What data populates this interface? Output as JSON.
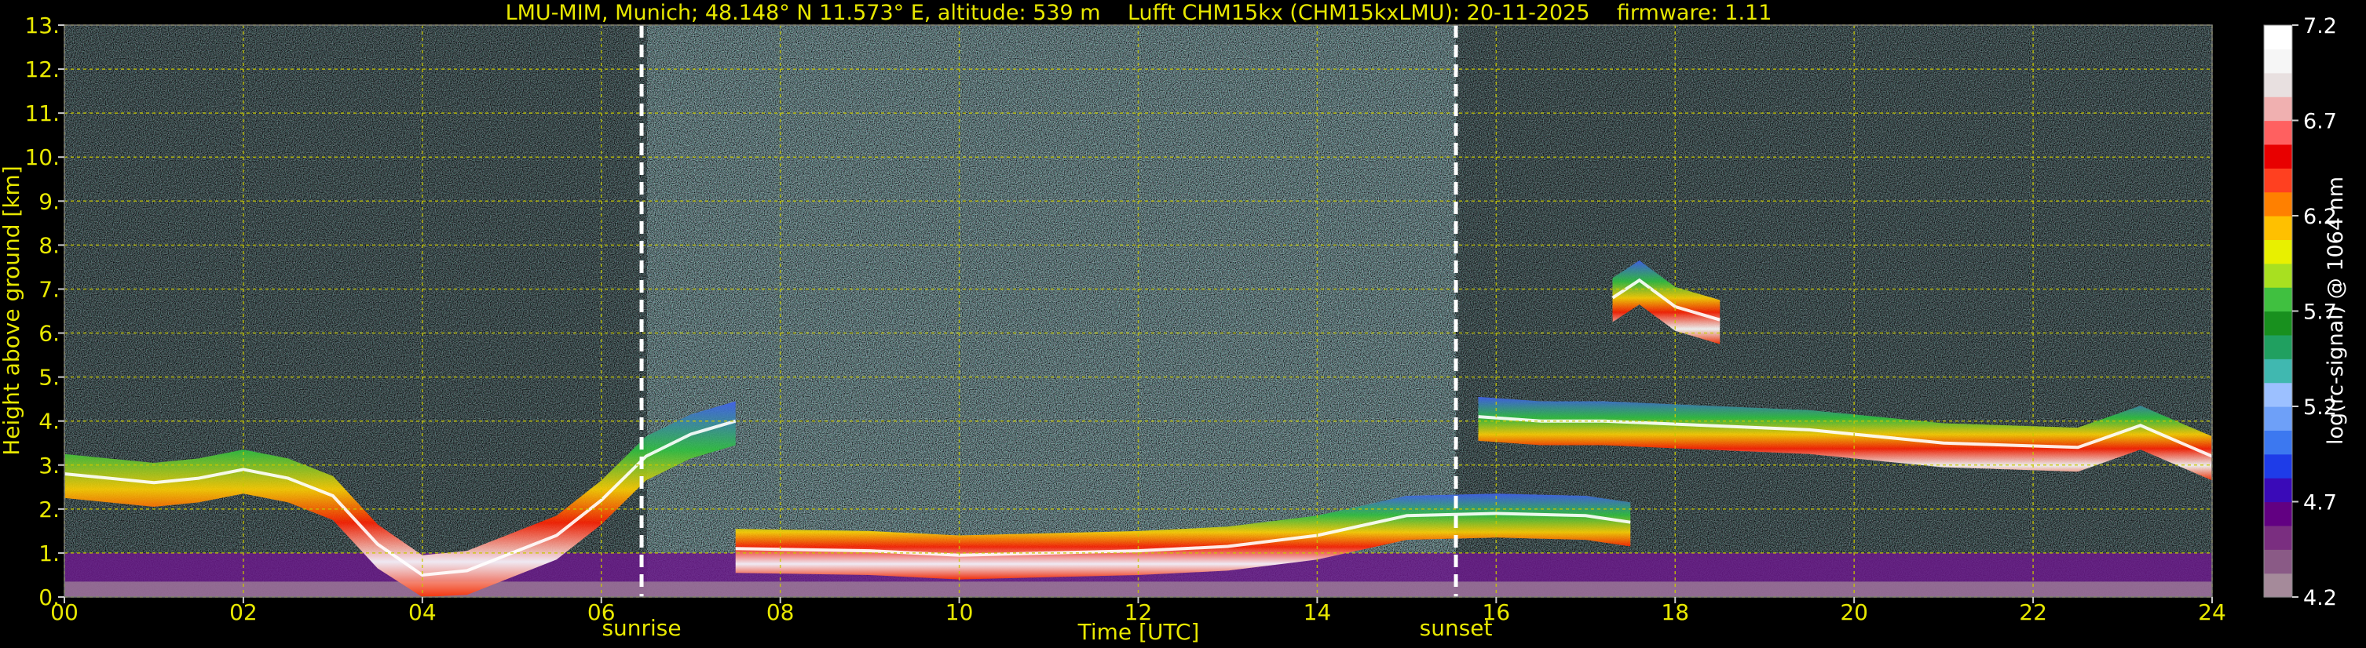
{
  "chart_data": {
    "type": "heatmap",
    "title": "LMU-MIM, Munich; 48.148° N 11.573° E, altitude: 539 m    Lufft CHM15kx (CHM15kxLMU): 20-11-2025    firmware: 1.11",
    "xlabel": "Time [UTC]",
    "ylabel": "Height above ground [km]",
    "colorbar_label": "log(rc-signal) @ 1064 nm",
    "xlim": [
      0,
      24
    ],
    "ylim": [
      0,
      13
    ],
    "x_ticks": [
      0,
      2,
      4,
      6,
      8,
      10,
      12,
      14,
      16,
      18,
      20,
      22,
      24
    ],
    "x_tick_labels": [
      "00",
      "02",
      "04",
      "06",
      "08",
      "10",
      "12",
      "14",
      "16",
      "18",
      "20",
      "22",
      "24"
    ],
    "y_ticks": [
      0,
      1,
      2,
      3,
      4,
      5,
      6,
      7,
      8,
      9,
      10,
      11,
      12,
      13
    ],
    "y_tick_labels": [
      "0.",
      "1.",
      "2.",
      "3.",
      "4.",
      "5.",
      "6.",
      "7.",
      "8.",
      "9.",
      "10.",
      "11.",
      "12.",
      "13."
    ],
    "colorbar_ticks": [
      4.2,
      4.7,
      5.2,
      5.7,
      6.2,
      6.7,
      7.2
    ],
    "colorbar_tick_labels": [
      "4.2",
      "4.7",
      "5.2",
      "5.7",
      "6.2",
      "6.7",
      "7.2"
    ],
    "colorbar_range": [
      4.2,
      7.2
    ],
    "grid": true,
    "markers": [
      {
        "label": "sunrise",
        "x": 6.45
      },
      {
        "label": "sunset",
        "x": 15.55
      }
    ],
    "layers": [
      {
        "x": [
          0,
          1,
          1.5,
          2,
          2.5,
          3,
          3.5,
          4,
          4.5,
          5,
          5.5,
          6,
          6.5,
          7,
          7.5
        ],
        "y": [
          2.8,
          2.6,
          2.7,
          2.9,
          2.7,
          2.3,
          1.2,
          0.5,
          0.6,
          1.0,
          1.4,
          2.2,
          3.2,
          3.7,
          4.0
        ]
      },
      {
        "x": [
          7.5,
          9,
          10,
          11,
          12,
          13,
          14,
          15,
          16,
          17,
          17.5
        ],
        "y": [
          1.1,
          1.05,
          0.95,
          1.0,
          1.05,
          1.15,
          1.4,
          1.85,
          1.9,
          1.85,
          1.7
        ]
      },
      {
        "x": [
          17.3,
          17.6,
          18,
          18.5
        ],
        "y": [
          6.8,
          7.2,
          6.6,
          6.3
        ]
      },
      {
        "x": [
          15.8,
          16.5,
          17.2,
          19.5,
          21,
          22.5,
          23.2,
          24
        ],
        "y": [
          4.1,
          4.0,
          4.0,
          3.8,
          3.5,
          3.4,
          3.9,
          3.2
        ]
      }
    ],
    "colors": {
      "text": "#e8e800",
      "colorbar_text": "#ffffff",
      "grid": "#c8c800",
      "background": "#000000",
      "marker": "#ffffff"
    },
    "colormap": [
      "#a58a9a",
      "#8a5a86",
      "#7a2e80",
      "#620082",
      "#3a0ab8",
      "#1e3ce8",
      "#3c78f0",
      "#6ea0f8",
      "#9cc0ff",
      "#40b8b0",
      "#20a060",
      "#18901e",
      "#40c040",
      "#a8e020",
      "#e8f000",
      "#ffc000",
      "#ff8000",
      "#ff4020",
      "#e80000",
      "#ff6060",
      "#f0b0b0",
      "#e8e0e0",
      "#f6f6f6",
      "#ffffff"
    ]
  }
}
